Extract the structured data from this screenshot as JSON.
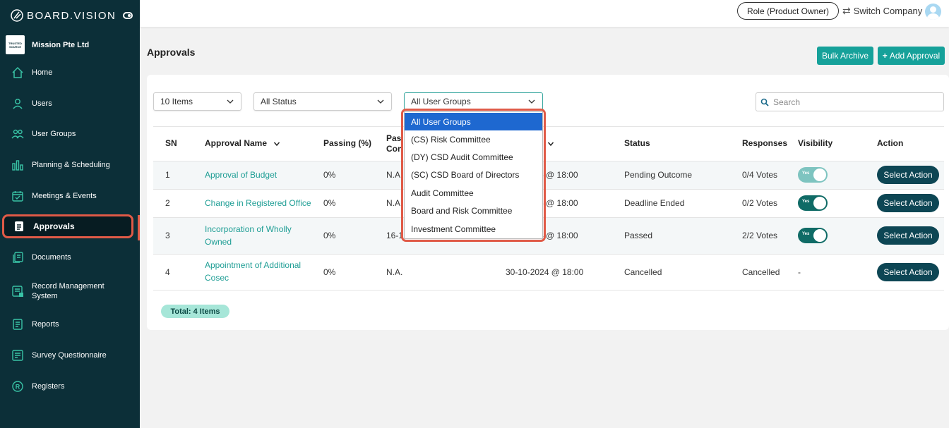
{
  "brand": {
    "name": "BOARD.VISION"
  },
  "company": {
    "logo_text": "TRUSTED SOURCE",
    "name": "Mission Pte Ltd"
  },
  "sidebar": {
    "items": [
      {
        "label": "Home",
        "icon": "home-icon"
      },
      {
        "label": "Users",
        "icon": "user-icon"
      },
      {
        "label": "User Groups",
        "icon": "user-group-icon"
      },
      {
        "label": "Planning & Scheduling",
        "icon": "bar-chart-icon"
      },
      {
        "label": "Meetings & Events",
        "icon": "calendar-icon"
      },
      {
        "label": "Approvals",
        "icon": "document-icon",
        "active": true
      },
      {
        "label": "Documents",
        "icon": "documents-icon"
      },
      {
        "label": "Record Management System",
        "icon": "record-icon"
      },
      {
        "label": "Reports",
        "icon": "report-icon"
      },
      {
        "label": "Survey Questionnaire",
        "icon": "survey-icon"
      },
      {
        "label": "Registers",
        "icon": "registered-icon"
      }
    ]
  },
  "topbar": {
    "role_label": "Role (Product Owner)",
    "switch_label": "Switch Company"
  },
  "page": {
    "title": "Approvals",
    "bulk_archive_label": "Bulk Archive",
    "add_approval_label": "Add Approval",
    "add_icon": "+"
  },
  "filters": {
    "items_per_page": "10 Items",
    "status": "All Status",
    "user_groups": "All User Groups",
    "search_placeholder": "Search"
  },
  "table": {
    "headers": {
      "sn": "SN",
      "name": "Approval Name",
      "passing": "Passing (%)",
      "pass_con_1": "Pas",
      "pass_con_2": "Con",
      "status": "Status",
      "responses": "Responses",
      "visibility": "Visibility",
      "action": "Action"
    },
    "rows": [
      {
        "sn": "1",
        "name_1": "Approval of Budget",
        "name_2": "",
        "passing": "0%",
        "pass_con": "N.A",
        "deadline": "5 @ 18:00",
        "status": "Pending Outcome",
        "responses": "0/4 Votes",
        "visibility": "Yes",
        "action": "Select Action"
      },
      {
        "sn": "2",
        "name_1": "Change in Registered Office",
        "name_2": "",
        "passing": "0%",
        "pass_con": "N.A",
        "deadline": "5 @ 18:00",
        "status": "Deadline Ended",
        "responses": "0/2 Votes",
        "visibility": "Yes",
        "action": "Select Action"
      },
      {
        "sn": "3",
        "name_1": "Incorporation of Wholly",
        "name_2": "Owned",
        "passing": "0%",
        "pass_con": "16-1",
        "deadline": "4 @ 18:00",
        "status": "Passed",
        "responses": "2/2 Votes",
        "visibility": "Yes",
        "action": "Select Action"
      },
      {
        "sn": "4",
        "name_1": "Appointment of Additional",
        "name_2": "Cosec",
        "passing": "0%",
        "pass_con": "N.A.",
        "deadline": "30-10-2024 @ 18:00",
        "status": "Cancelled",
        "responses": "Cancelled",
        "visibility": "-",
        "action": "Select Action"
      }
    ],
    "total_label": "Total: 4 Items"
  },
  "dropdown": {
    "options": [
      "All User Groups",
      "(CS) Risk Committee",
      "(DY) CSD Audit Committee",
      "(SC) CSD Board of Directors",
      "Audit Committee",
      "Board and Risk Committee",
      "Investment Committee"
    ],
    "selected_index": 0
  },
  "colors": {
    "sidebar_bg": "#0c2f38",
    "accent": "#16a19a",
    "highlight": "#e05a47",
    "action_btn": "#0d4654",
    "selected_option": "#1e68d0"
  }
}
